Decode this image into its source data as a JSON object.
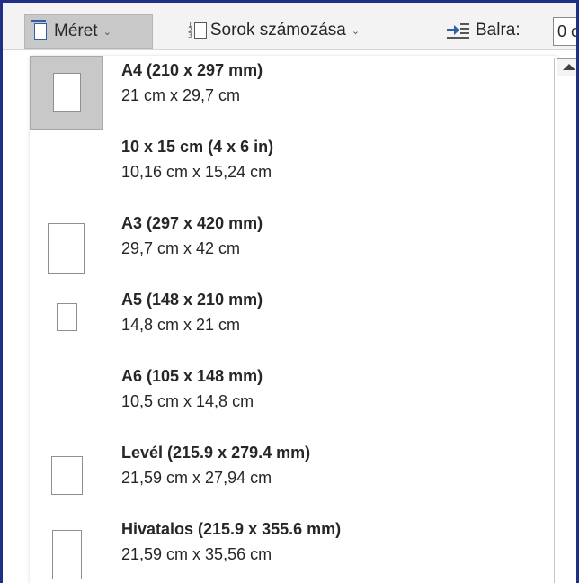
{
  "toolbar": {
    "size_label": "Méret",
    "line_numbers_label": "Sorok számozása",
    "indent_label": "Balra:",
    "indent_value": "0 c"
  },
  "paper_sizes": [
    {
      "name": "A4 (210 x 297 mm)",
      "dims": "21 cm x 29,7 cm",
      "selected": true
    },
    {
      "name": "10 x 15 cm (4 x 6 in)",
      "dims": "10,16 cm x 15,24 cm",
      "selected": false
    },
    {
      "name": "A3 (297 x 420 mm)",
      "dims": "29,7 cm x 42 cm",
      "selected": false
    },
    {
      "name": "A5 (148 x 210 mm)",
      "dims": "14,8 cm x 21 cm",
      "selected": false
    },
    {
      "name": "A6 (105 x 148 mm)",
      "dims": "10,5 cm x 14,8 cm",
      "selected": false
    },
    {
      "name": "Levél (215.9 x 279.4 mm)",
      "dims": "21,59 cm x 27,94 cm",
      "selected": false
    },
    {
      "name": "Hivatalos (215.9 x 355.6 mm)",
      "dims": "21,59 cm x 35,56 cm",
      "selected": false
    }
  ],
  "colors": {
    "frame_border": "#1f2f86",
    "selected_bg": "#c8c8c8",
    "icon_blue": "#2f5fa6"
  }
}
